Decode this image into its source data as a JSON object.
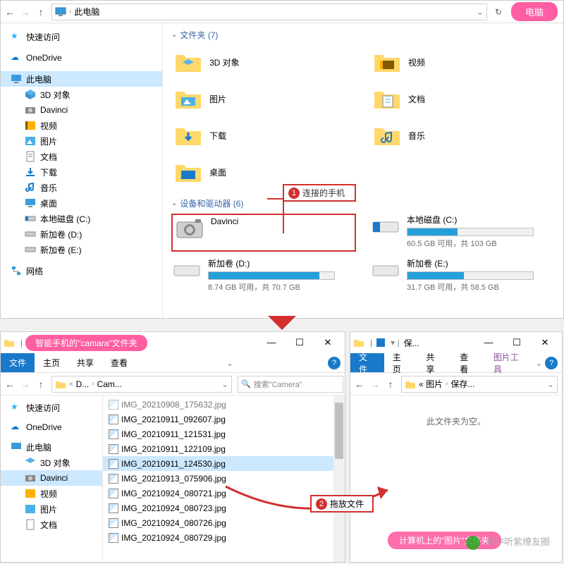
{
  "top": {
    "breadcrumb": "此电脑",
    "pink_label": "电脑",
    "sidebar": {
      "quick": "快速访问",
      "onedrive": "OneDrive",
      "thispc": "此电脑",
      "items": [
        "3D 对象",
        "Davinci",
        "视频",
        "图片",
        "文档",
        "下载",
        "音乐",
        "桌面",
        "本地磁盘 (C:)",
        "新加卷 (D:)",
        "新加卷 (E:)"
      ],
      "network": "网络"
    },
    "folders_header": "文件夹 (7)",
    "folders": [
      "3D 对象",
      "视频",
      "图片",
      "文档",
      "下载",
      "音乐",
      "桌面"
    ],
    "annot1": "连接的手机",
    "drives_header": "设备和驱动器 (6)",
    "device_name": "Davinci",
    "drives": [
      {
        "name": "本地磁盘 (C:)",
        "status": "60.5 GB 可用，共 103 GB",
        "fill": 40
      },
      {
        "name": "新加卷 (D:)",
        "status": "8.74 GB 可用，共 70.7 GB",
        "fill": 88
      },
      {
        "name": "新加卷 (E:)",
        "status": "31.7 GB 可用，共 58.5 GB",
        "fill": 45
      }
    ]
  },
  "bl": {
    "title_pill": "智能手机的\"camara\"文件夹",
    "ribbon": {
      "file": "文件",
      "home": "主页",
      "share": "共享",
      "view": "查看"
    },
    "crumb1": "D...",
    "crumb2": "Cam...",
    "search_ph": "搜索\"Camera\"",
    "sidebar": {
      "quick": "快速访问",
      "onedrive": "OneDrive",
      "thispc": "此电脑",
      "items": [
        "3D 对象",
        "Davinci",
        "视频",
        "图片",
        "文档"
      ]
    },
    "files": [
      "IMG_20210908_175632.jpg",
      "IMG_20210911_092607.jpg",
      "IMG_20210911_121531.jpg",
      "IMG_20210911_122109.jpg",
      "IMG_20210911_124530.jpg",
      "IMG_20210913_075906.jpg",
      "IMG_20210924_080721.jpg",
      "IMG_20210924_080723.jpg",
      "IMG_20210924_080726.jpg",
      "IMG_20210924_080729.jpg"
    ]
  },
  "br": {
    "title_crumb": "保...",
    "ribbon": {
      "file": "文件",
      "home": "主页",
      "share": "共享",
      "view": "查看",
      "pic": "图片工具"
    },
    "crumb1": "« 图片",
    "crumb2": "保存...",
    "empty": "此文件夹为空。"
  },
  "annot2": "拖放文件",
  "bottom_pill": "计算机上的\"图片\"文件夹",
  "watermark": "掌中听紫燎友圈"
}
